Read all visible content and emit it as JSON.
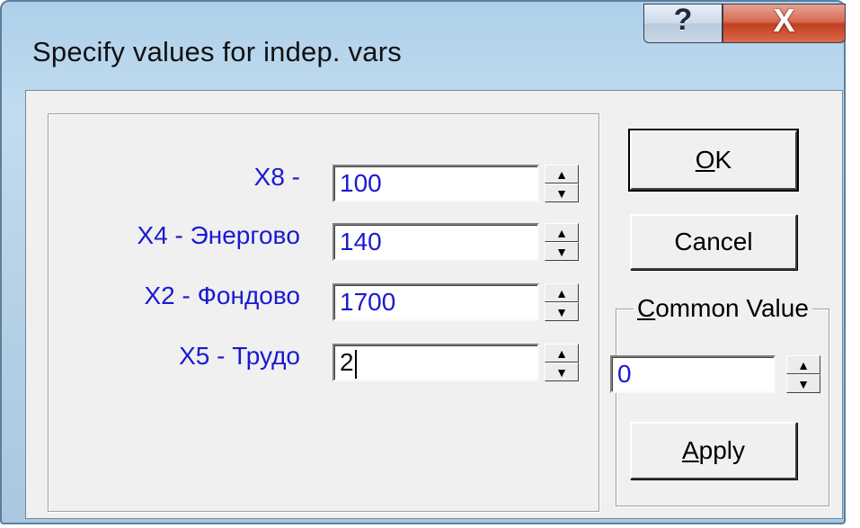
{
  "window": {
    "title": "Specify values for indep. vars",
    "help_label": "?",
    "close_label": "X"
  },
  "variables": [
    {
      "label": "X8 -",
      "value": "100"
    },
    {
      "label": "X4 - Энерговo",
      "value": "140"
    },
    {
      "label": "X2 - Фондово",
      "value": "1700"
    },
    {
      "label": "X5 - Трудо",
      "value": "2"
    }
  ],
  "buttons": {
    "ok_label_underlined": "O",
    "ok_label_rest": "K",
    "cancel_label": "Cancel",
    "apply_label_underlined": "A",
    "apply_label_rest": "pply"
  },
  "common_value": {
    "legend_underlined": "C",
    "legend_rest": "ommon Value",
    "value": "0"
  },
  "spin": {
    "up": "▲",
    "down": "▼"
  },
  "colors": {
    "label_blue": "#1a1ad0",
    "close_red": "#c2401f"
  }
}
